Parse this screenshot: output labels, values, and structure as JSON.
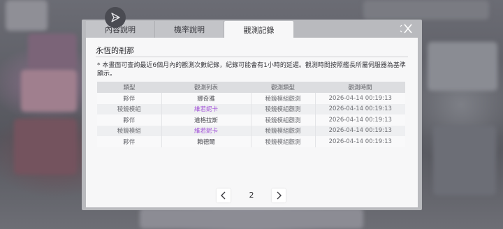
{
  "tabs": [
    {
      "label": "內容說明",
      "active": false
    },
    {
      "label": "機率說明",
      "active": false
    },
    {
      "label": "觀測記錄",
      "active": true
    }
  ],
  "panel": {
    "title": "永恆的剎那",
    "notice": "* 本畫面可查詢最近6個月內的觀測次數紀錄，紀錄可能會有1小時的延遲。觀測時間按照艦長所屬伺服器為基準顯示。"
  },
  "table": {
    "headers": [
      "類型",
      "觀測列表",
      "觀測類型",
      "觀測時間"
    ],
    "rows": [
      {
        "type": "夥伴",
        "name": "娜奇雅",
        "highlight": false,
        "obs_type": "稜鏡模組觀測",
        "time": "2026-04-14 00:19:13"
      },
      {
        "type": "稜鏡模組",
        "name": "維若妮卡",
        "highlight": true,
        "obs_type": "稜鏡模組觀測",
        "time": "2026-04-14 00:19:13"
      },
      {
        "type": "夥伴",
        "name": "道格拉斯",
        "highlight": false,
        "obs_type": "稜鏡模組觀測",
        "time": "2026-04-14 00:19:13"
      },
      {
        "type": "稜鏡模組",
        "name": "維若妮卡",
        "highlight": true,
        "obs_type": "稜鏡模組觀測",
        "time": "2026-04-14 00:19:13"
      },
      {
        "type": "夥伴",
        "name": "賴德爾",
        "highlight": false,
        "obs_type": "稜鏡模組觀測",
        "time": "2026-04-14 00:19:13"
      }
    ]
  },
  "pager": {
    "current_page": "2",
    "prev_icon": "chevron-left-icon",
    "next_icon": "chevron-right-icon"
  },
  "icons": {
    "close": "close-icon",
    "floating": "play-icon"
  },
  "colors": {
    "highlight_name": "#a253d8",
    "active_tab": "#f7f7f8"
  }
}
